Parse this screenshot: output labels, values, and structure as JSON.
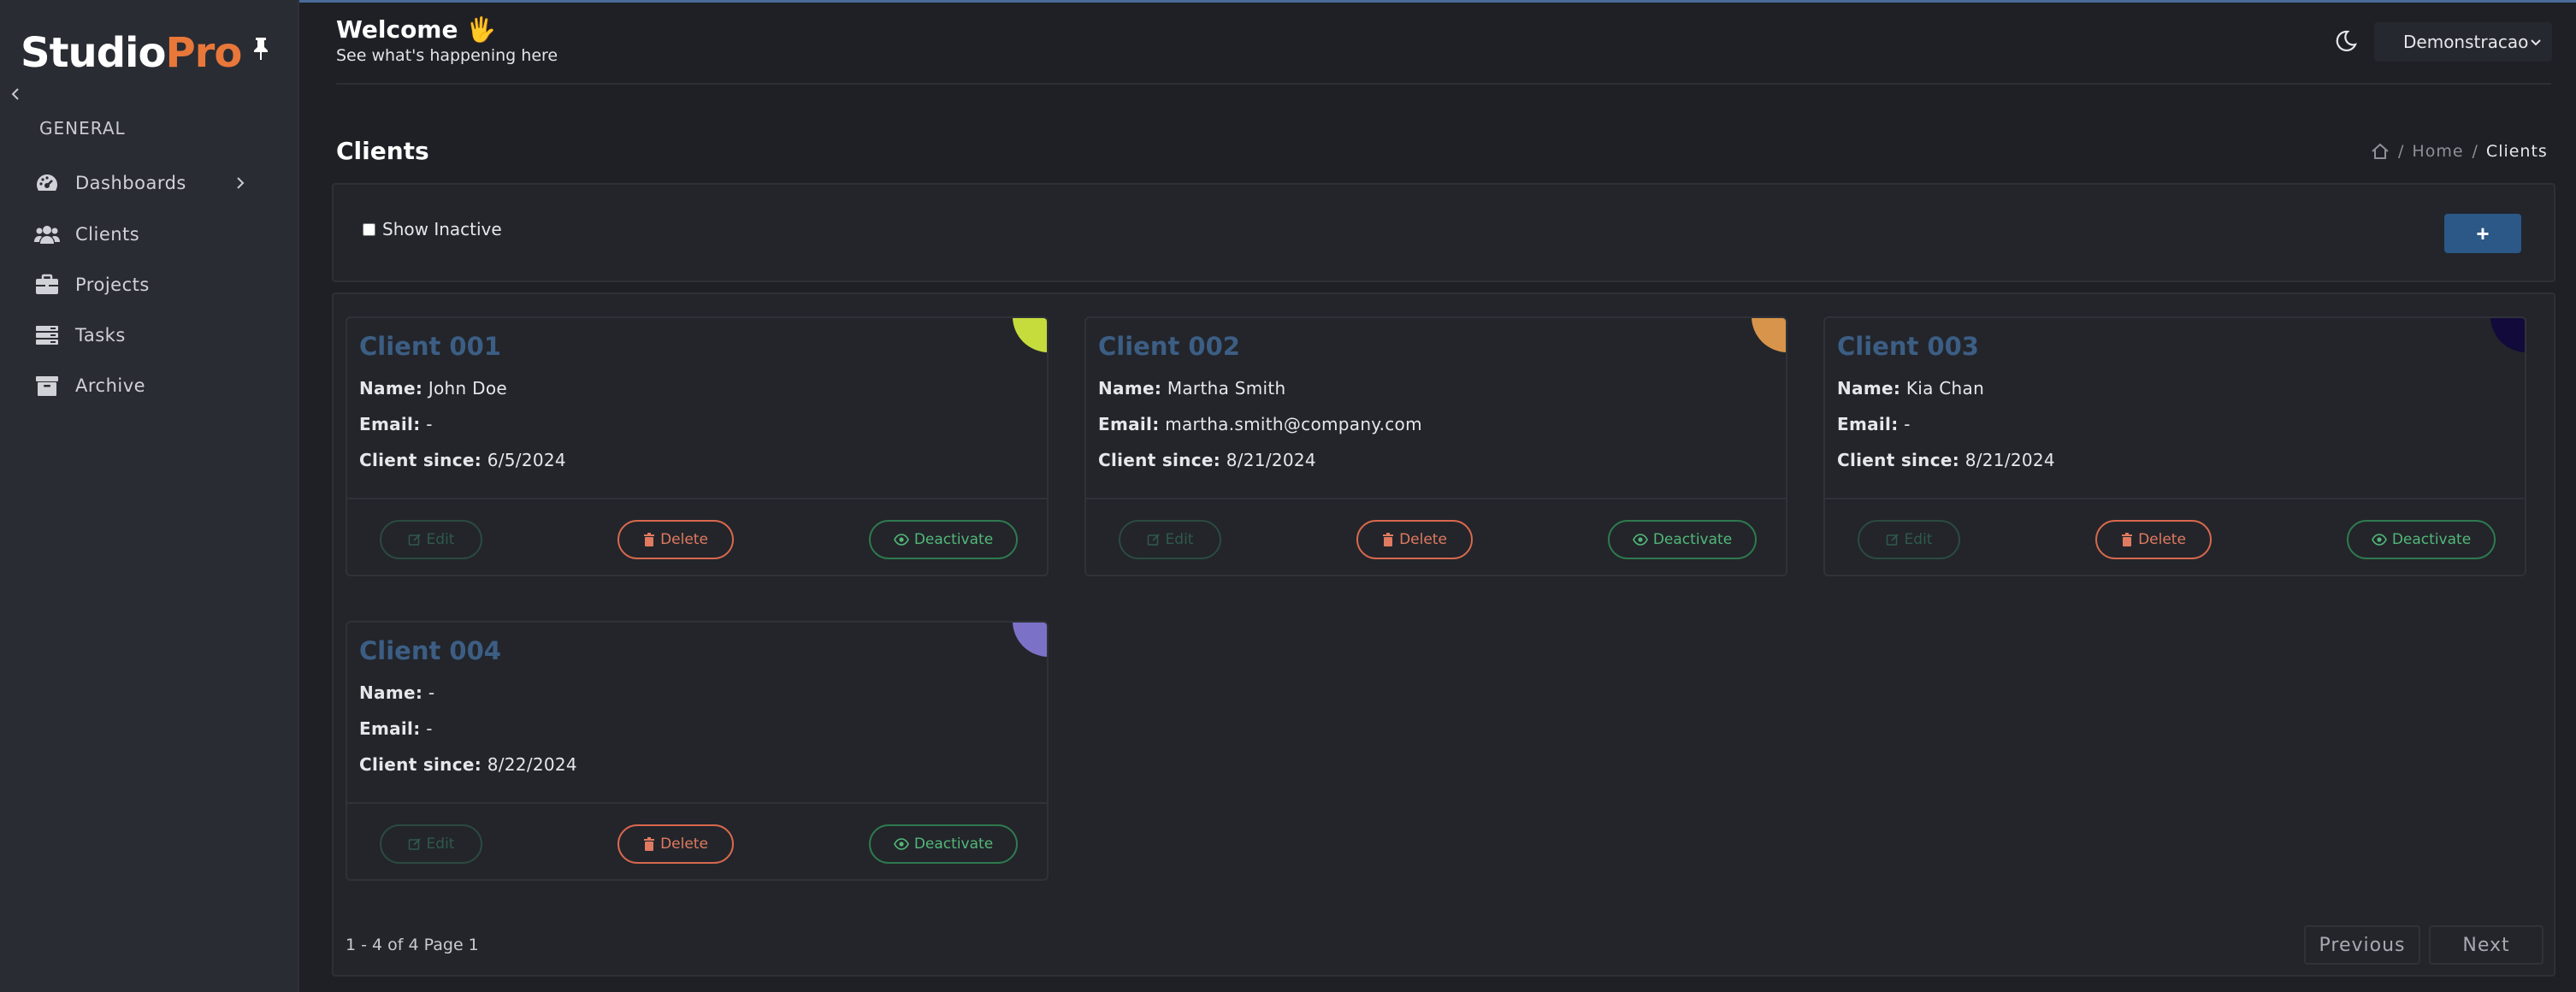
{
  "app": {
    "logo_studio": "Studio",
    "logo_pro": "Pro"
  },
  "sidebar": {
    "section": "GENERAL",
    "items": [
      {
        "label": "Dashboards",
        "icon": "dashboard-icon",
        "has_submenu": true
      },
      {
        "label": "Clients",
        "icon": "users-icon"
      },
      {
        "label": "Projects",
        "icon": "briefcase-icon"
      },
      {
        "label": "Tasks",
        "icon": "tasks-icon"
      },
      {
        "label": "Archive",
        "icon": "archive-icon"
      }
    ]
  },
  "header": {
    "welcome": "Welcome 🖐",
    "subtitle": "See what's happening here",
    "user": "Demonstracao"
  },
  "page": {
    "title": "Clients",
    "breadcrumb_home": "Home",
    "breadcrumb_current": "Clients"
  },
  "filter": {
    "show_inactive_label": "Show Inactive",
    "show_inactive_checked": false,
    "add_label": "+"
  },
  "labels": {
    "name": "Name:",
    "email": "Email:",
    "since": "Client since:",
    "edit": "Edit",
    "delete": "Delete",
    "deactivate": "Deactivate"
  },
  "clients": [
    {
      "title": "Client 001",
      "name": "John Doe",
      "email": "-",
      "since": "6/5/2024",
      "color": "#c5dc3c"
    },
    {
      "title": "Client 002",
      "name": "Martha Smith",
      "email": "martha.smith@company.com",
      "since": "8/21/2024",
      "color": "#d7944a"
    },
    {
      "title": "Client 003",
      "name": "Kia Chan",
      "email": "-",
      "since": "8/21/2024",
      "color": "#120a3a"
    },
    {
      "title": "Client 004",
      "name": "-",
      "email": "-",
      "since": "8/22/2024",
      "color": "#7b72c8"
    }
  ],
  "pagination": {
    "summary": "1 - 4 of 4 Page 1",
    "previous": "Previous",
    "next": "Next"
  },
  "colors": {
    "accent": "#2b5887",
    "brand_orange": "#e8773a",
    "delete": "#d8684d",
    "deactivate": "#52b878"
  }
}
